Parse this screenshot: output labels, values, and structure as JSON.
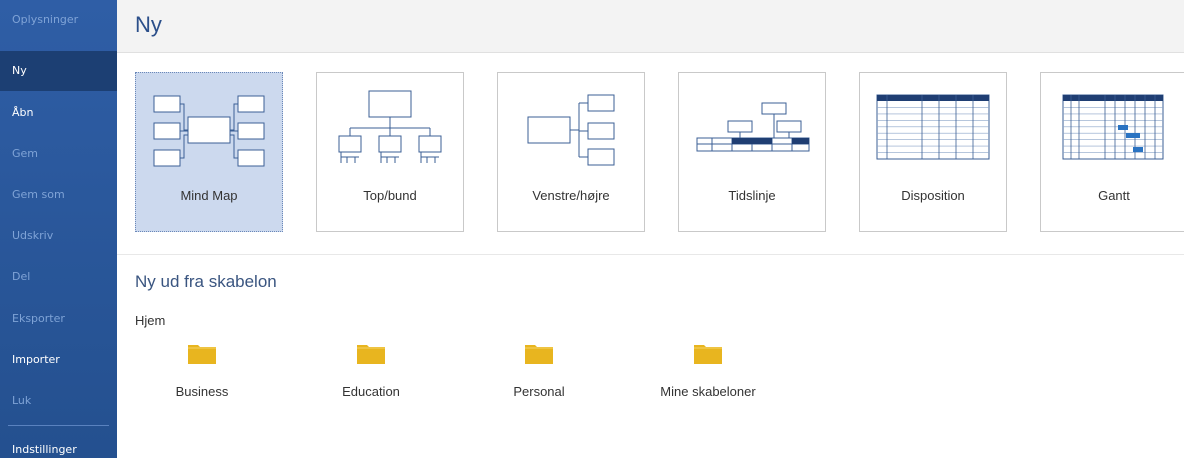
{
  "sidebar": {
    "items": [
      {
        "label": "Oplysninger",
        "state": "disabled"
      },
      {
        "label": "Ny",
        "state": "active"
      },
      {
        "label": "Åbn",
        "state": "enabled"
      },
      {
        "label": "Gem",
        "state": "disabled"
      },
      {
        "label": "Gem som",
        "state": "disabled"
      },
      {
        "label": "Udskriv",
        "state": "disabled"
      },
      {
        "label": "Del",
        "state": "disabled"
      },
      {
        "label": "Eksporter",
        "state": "disabled"
      },
      {
        "label": "Importer",
        "state": "enabled"
      },
      {
        "label": "Luk",
        "state": "disabled"
      },
      {
        "label": "Indstillinger",
        "state": "enabled"
      }
    ]
  },
  "header": {
    "title": "Ny"
  },
  "tiles": [
    {
      "label": "Mind Map",
      "icon": "mind-map-icon",
      "selected": true
    },
    {
      "label": "Top/bund",
      "icon": "top-bottom-icon"
    },
    {
      "label": "Venstre/højre",
      "icon": "left-right-icon"
    },
    {
      "label": "Tidslinje",
      "icon": "timeline-icon"
    },
    {
      "label": "Disposition",
      "icon": "outline-table-icon"
    },
    {
      "label": "Gantt",
      "icon": "gantt-icon"
    }
  ],
  "templates": {
    "title": "Ny ud fra skabelon",
    "group": "Hjem",
    "folders": [
      {
        "label": "Business",
        "icon": "folder-icon"
      },
      {
        "label": "Education",
        "icon": "folder-icon"
      },
      {
        "label": "Personal",
        "icon": "folder-icon"
      },
      {
        "label": "Mine skabeloner",
        "icon": "folder-icon"
      }
    ]
  },
  "colors": {
    "sidebar": "#2b579a",
    "accent": "#2b4f8a",
    "selected_tile": "#ccd9ee",
    "folder": "#e8b51f"
  }
}
